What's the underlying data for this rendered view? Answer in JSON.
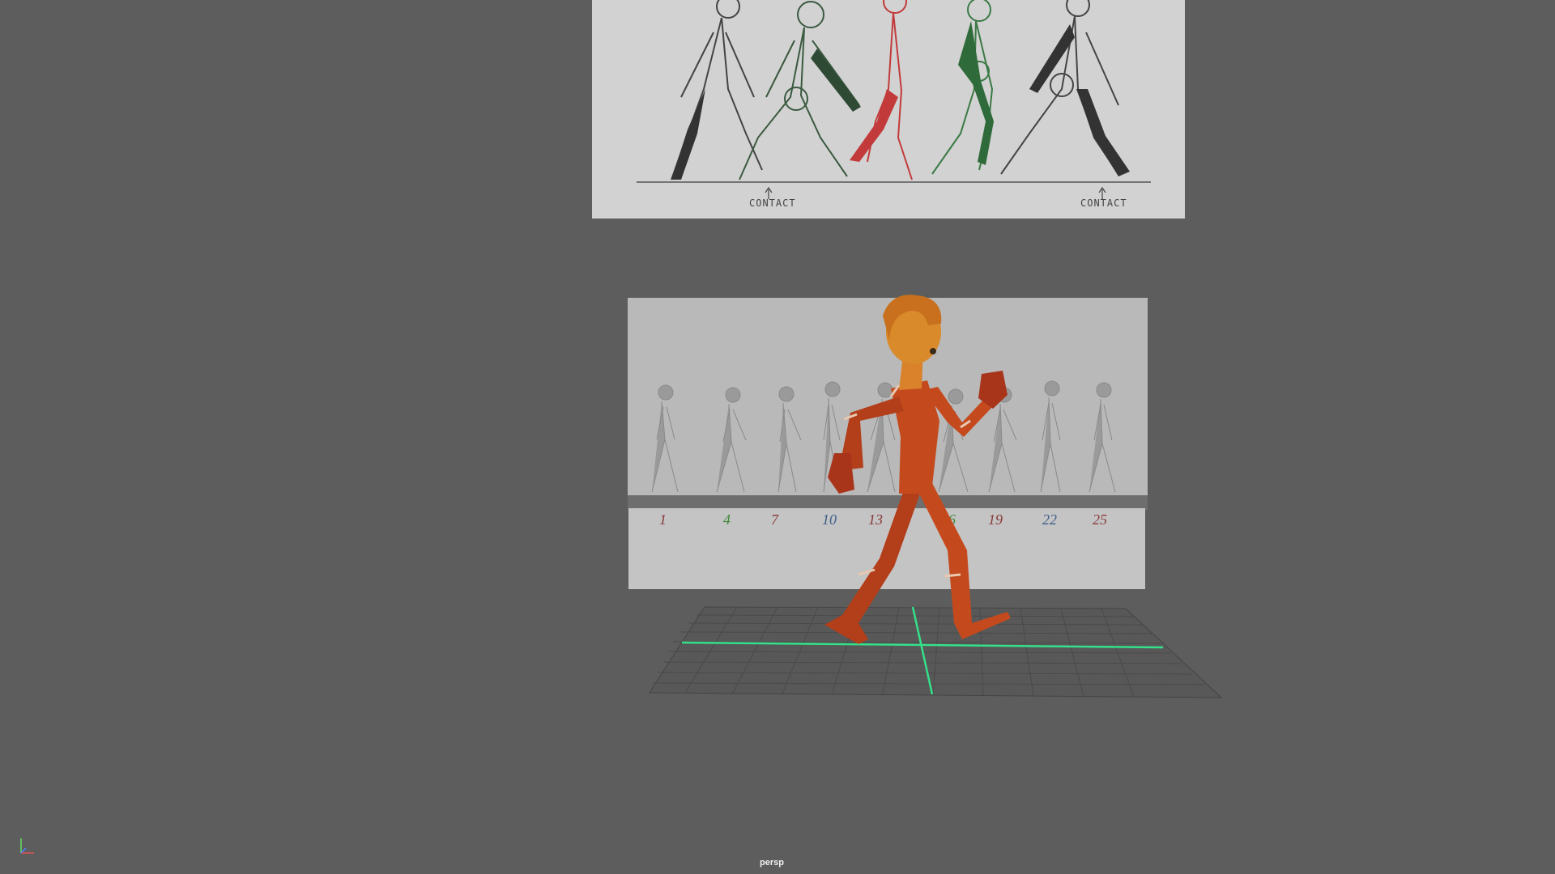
{
  "viewport": {
    "camera_label": "persp",
    "background": "#5d5d5d"
  },
  "reference_sketch": {
    "labels": [
      "CONTACT",
      "CONTACT"
    ]
  },
  "pose_chart": {
    "frames": [
      {
        "label": "1",
        "color": "#8a3a3a"
      },
      {
        "label": "4",
        "color": "#3f8a3a"
      },
      {
        "label": "7",
        "color": "#8a3a3a"
      },
      {
        "label": "10",
        "color": "#3d5e8a"
      },
      {
        "label": "13",
        "color": "#8a3a3a"
      },
      {
        "label": "16",
        "color": "#3f8a3a"
      },
      {
        "label": "19",
        "color": "#8a3a3a"
      },
      {
        "label": "22",
        "color": "#3d5e8a"
      },
      {
        "label": "25",
        "color": "#8a3a3a"
      }
    ]
  },
  "colors": {
    "grid_axis": "#34e08a",
    "character_body": "#c44a1e",
    "character_hair": "#d98a2b"
  },
  "axis_icons": [
    "axis-gizmo-icon"
  ]
}
